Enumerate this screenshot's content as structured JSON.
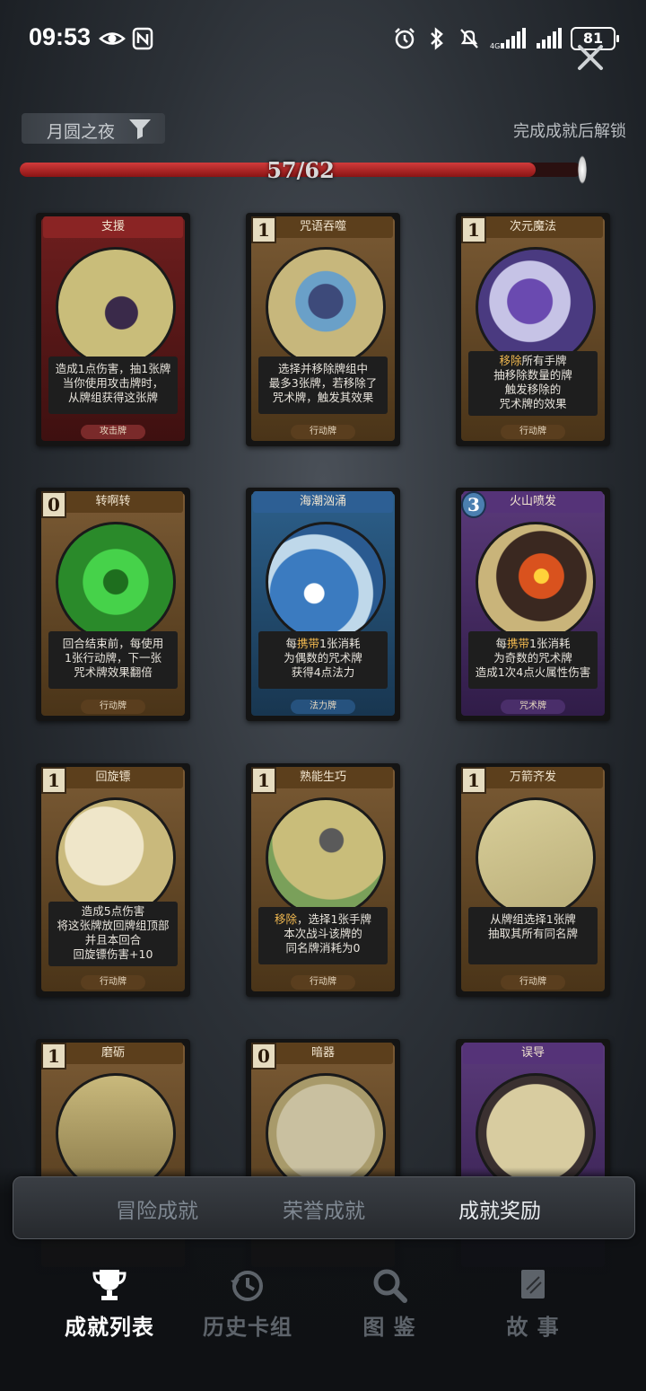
{
  "status_bar": {
    "time": "09:53",
    "battery": "81",
    "icons": [
      "eye-icon",
      "nfc-icon",
      "alarm-icon",
      "bluetooth-icon",
      "mute-icon",
      "signal-icon",
      "signal-icon"
    ]
  },
  "header": {
    "chapter_label": "月圆之夜",
    "unlock_text": "完成成就后解锁",
    "progress_text": "57/62",
    "progress_value": 0.919
  },
  "cards": [
    {
      "title": "支援",
      "cost": "",
      "frame": "red",
      "desc_lines": [
        "造成1点伤害，抽1张牌",
        "当你使用攻击牌时，",
        "从牌组获得这张牌"
      ],
      "type": "攻击牌"
    },
    {
      "title": "咒语吞噬",
      "cost": "1",
      "frame": "brown",
      "desc_lines": [
        "选择并移除牌组中",
        "最多3张牌，若移除了",
        "咒术牌，触发其效果"
      ],
      "type": "行动牌"
    },
    {
      "title": "次元魔法",
      "cost": "1",
      "frame": "brown",
      "desc_lines": [
        "移除所有手牌",
        "抽移除数量的牌",
        "触发移除的",
        "咒术牌的效果"
      ],
      "type": "行动牌"
    },
    {
      "title": "转啊转",
      "cost": "0",
      "frame": "brown",
      "desc_lines": [
        "回合结束前，每使用",
        "1张行动牌，下一张",
        "咒术牌效果翻倍"
      ],
      "type": "行动牌"
    },
    {
      "title": "海潮汹涌",
      "cost": "",
      "frame": "blue",
      "desc_lines": [
        "每携带1张消耗",
        "为偶数的咒术牌",
        "获得4点法力"
      ],
      "type": "法力牌"
    },
    {
      "title": "火山喷发",
      "cost": "3",
      "frame": "purple",
      "desc_lines": [
        "每携带1张消耗",
        "为奇数的咒术牌",
        "造成1次4点火属性伤害"
      ],
      "type": "咒术牌"
    },
    {
      "title": "回旋镖",
      "cost": "1",
      "frame": "brown",
      "desc_lines": [
        "造成5点伤害",
        "将这张牌放回牌组顶部",
        "并且本回合",
        "回旋镖伤害+10"
      ],
      "type": "行动牌"
    },
    {
      "title": "熟能生巧",
      "cost": "1",
      "frame": "brown",
      "desc_lines": [
        "移除，选择1张手牌",
        "本次战斗该牌的",
        "同名牌消耗为0"
      ],
      "type": "行动牌"
    },
    {
      "title": "万箭齐发",
      "cost": "1",
      "frame": "brown",
      "desc_lines": [
        "从牌组选择1张牌",
        "抽取其所有同名牌"
      ],
      "type": "行动牌"
    },
    {
      "title": "磨砺",
      "cost": "1",
      "frame": "brown",
      "desc_lines": [],
      "type": ""
    },
    {
      "title": "暗器",
      "cost": "0",
      "frame": "brown",
      "desc_lines": [],
      "type": ""
    },
    {
      "title": "误导",
      "cost": "",
      "frame": "purple",
      "desc_lines": [],
      "type": ""
    }
  ],
  "subtabs": [
    "冒险成就",
    "荣誉成就",
    "成就奖励"
  ],
  "nav": [
    {
      "label": "成就列表",
      "icon": "trophy-icon"
    },
    {
      "label": "历史卡组",
      "icon": "history-icon"
    },
    {
      "label": "图 鉴",
      "icon": "magnifier-icon"
    },
    {
      "label": "故 事",
      "icon": "book-icon"
    }
  ]
}
